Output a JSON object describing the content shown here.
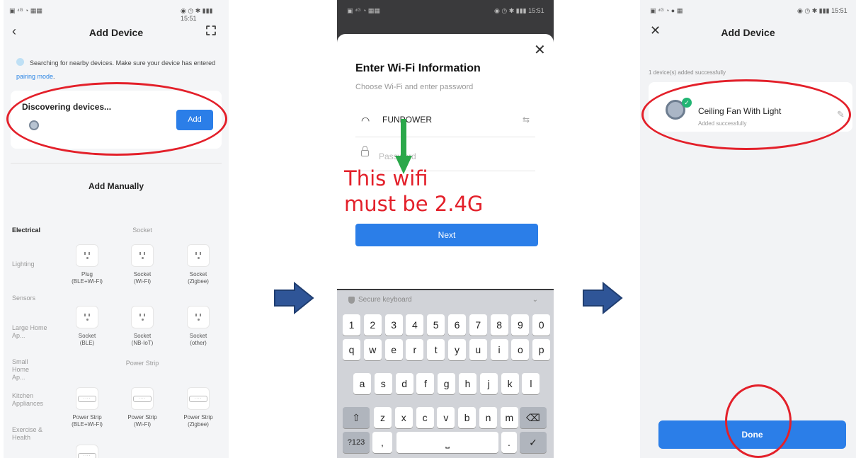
{
  "screen1": {
    "status_time": "15:51",
    "title": "Add Device",
    "back_icon": "chevron-left-icon",
    "scan_icon": "scan-icon",
    "search_text": "Searching for nearby devices. Make sure your device has entered",
    "pairing_link": "pairing mode",
    "search_suffix": ".",
    "discovering": "Discovering devices...",
    "add_label": "Add",
    "add_manually": "Add Manually",
    "categories": [
      "Electrical",
      "Lighting",
      "Sensors",
      "Large Home Ap...",
      "Small Home Ap...",
      "Kitchen Appliances",
      "Exercise & Health"
    ],
    "subsections": [
      "Socket",
      "Power Strip"
    ],
    "socket_items": [
      {
        "line1": "Plug",
        "line2": "(BLE+Wi-Fi)"
      },
      {
        "line1": "Socket",
        "line2": "(Wi-Fi)"
      },
      {
        "line1": "Socket",
        "line2": "(Zigbee)"
      },
      {
        "line1": "Socket",
        "line2": "(BLE)"
      },
      {
        "line1": "Socket",
        "line2": "(NB-IoT)"
      },
      {
        "line1": "Socket",
        "line2": "(other)"
      }
    ],
    "strip_items": [
      {
        "line1": "Power Strip",
        "line2": "(BLE+Wi-Fi)"
      },
      {
        "line1": "Power Strip",
        "line2": "(Wi-Fi)"
      },
      {
        "line1": "Power Strip",
        "line2": "(Zigbee)"
      }
    ]
  },
  "screen2": {
    "status_time": "15:51",
    "title": "Enter Wi-Fi Information",
    "subtitle": "Choose Wi-Fi and enter password",
    "wifi_name": "FUNPOWER",
    "password_placeholder": "Password",
    "note_line1": "This wifi",
    "note_line2": "must be 2.4G",
    "next_label": "Next",
    "keyboard_label": "Secure keyboard",
    "row_numbers": [
      "1",
      "2",
      "3",
      "4",
      "5",
      "6",
      "7",
      "8",
      "9",
      "0"
    ],
    "row_q": [
      "q",
      "w",
      "e",
      "r",
      "t",
      "y",
      "u",
      "i",
      "o",
      "p"
    ],
    "row_a": [
      "a",
      "s",
      "d",
      "f",
      "g",
      "h",
      "j",
      "k",
      "l"
    ],
    "row_z": [
      "z",
      "x",
      "c",
      "v",
      "b",
      "n",
      "m"
    ],
    "key_123": "?123",
    "key_comma": ",",
    "key_period": "."
  },
  "screen3": {
    "status_time": "15:51",
    "title": "Add Device",
    "added_info": "1 device(s) added successfully",
    "device_name": "Ceiling Fan With Light",
    "device_status": "Added successfully",
    "done_label": "Done"
  },
  "colors": {
    "accent": "#2b7ee8",
    "annotation": "#e3202a",
    "arrow": "#2f5597"
  }
}
